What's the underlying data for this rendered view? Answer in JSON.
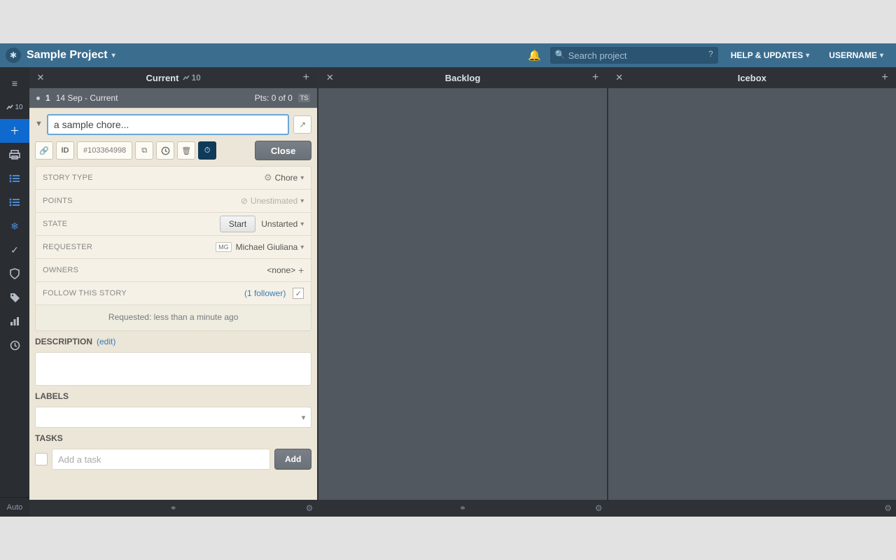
{
  "topbar": {
    "project_name": "Sample Project",
    "search_placeholder": "Search project",
    "help_label": "HELP & UPDATES",
    "username_label": "USERNAME"
  },
  "leftbar": {
    "velocity_value": "10",
    "footer_label": "Auto"
  },
  "panels": {
    "current": {
      "title": "Current",
      "velocity": "10"
    },
    "backlog": {
      "title": "Backlog"
    },
    "icebox": {
      "title": "Icebox"
    }
  },
  "iteration": {
    "number": "1",
    "range": "14 Sep - Current",
    "points_label": "Pts: 0 of 0",
    "badge": "TS"
  },
  "story": {
    "title_value": "a sample chore...",
    "id_prefix": "ID",
    "id_value": "#103364998",
    "close_label": "Close",
    "fields": {
      "story_type_label": "STORY TYPE",
      "story_type_value": "Chore",
      "points_label": "POINTS",
      "points_value": "Unestimated",
      "state_label": "STATE",
      "state_start_btn": "Start",
      "state_value": "Unstarted",
      "requester_label": "REQUESTER",
      "requester_initials": "MG",
      "requester_value": "Michael Giuliana",
      "owners_label": "OWNERS",
      "owners_value": "<none>",
      "follow_label": "FOLLOW THIS STORY",
      "follow_count_label": "(1 follower)"
    },
    "requested_text": "Requested: less than a minute ago",
    "description_label": "DESCRIPTION",
    "description_edit": "(edit)",
    "labels_label": "LABELS",
    "tasks_label": "TASKS",
    "task_placeholder": "Add a task",
    "task_add_btn": "Add"
  }
}
